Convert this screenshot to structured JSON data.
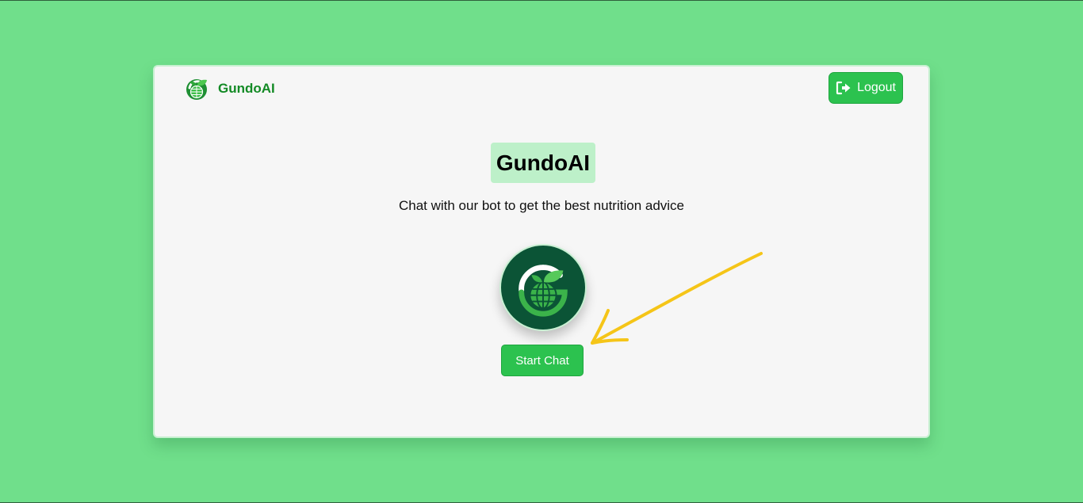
{
  "header": {
    "brand_name": "GundoAI",
    "logo_icon": "globe-leaf-logo-icon",
    "logout_label": "Logout",
    "logout_icon": "sign-out-icon"
  },
  "hero": {
    "title": "GundoAI",
    "subtitle": "Chat with our bot to get the best nutrition advice",
    "avatar_icon": "bot-globe-leaf-avatar-icon",
    "start_chat_label": "Start Chat"
  },
  "annotation": {
    "arrow_icon": "hand-drawn-arrow-icon",
    "arrow_color": "#f5c518"
  },
  "colors": {
    "background": "#70df8b",
    "card": "#f6f6f6",
    "accent": "#2cc24f",
    "brand_text": "#138a25",
    "title_highlight": "#bdf0c9",
    "avatar_bg": "#0b5436"
  }
}
